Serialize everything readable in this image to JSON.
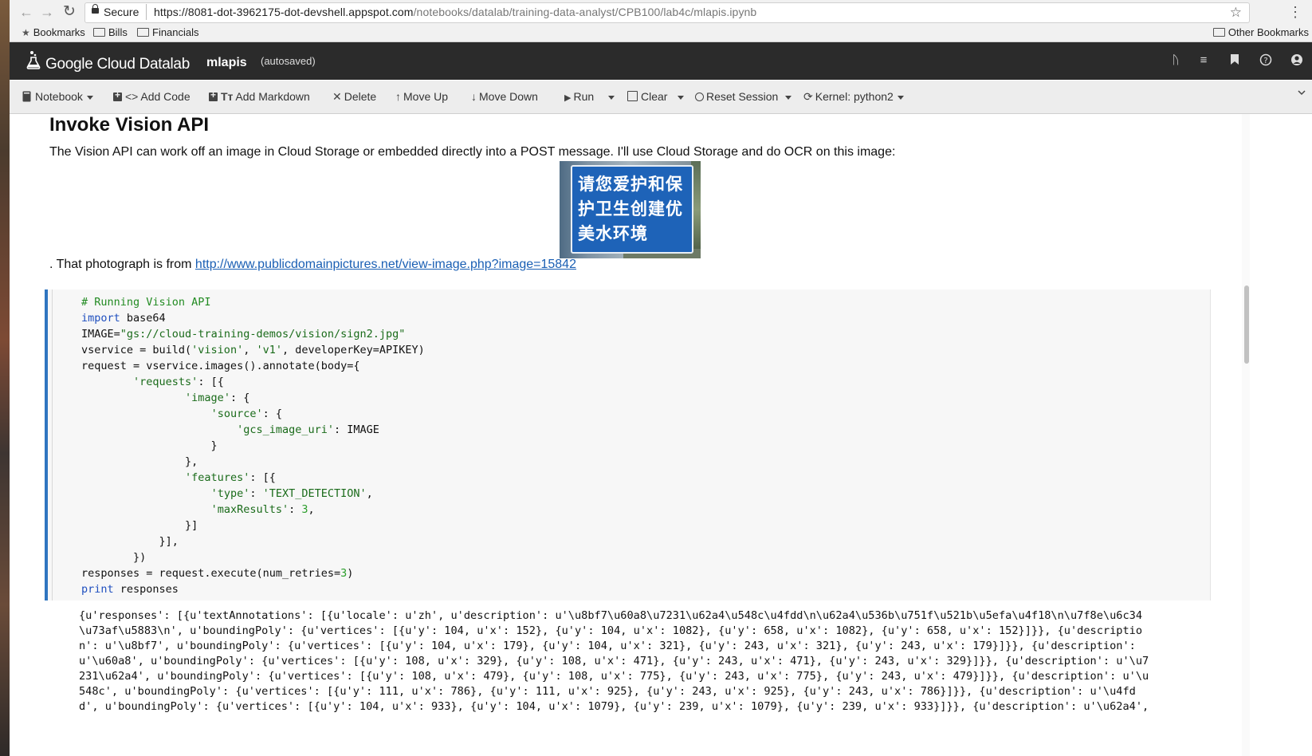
{
  "browser": {
    "secure_label": "Secure",
    "url_host": "https://8081-dot-3962175-dot-devshell.appspot.com",
    "url_path": "/notebooks/datalab/training-data-analyst/CPB100/lab4c/mlapis.ipynb",
    "bookmarks": [
      "Bookmarks",
      "Bills",
      "Financials"
    ],
    "other_bookmarks": "Other Bookmarks"
  },
  "header": {
    "logo": "Google Cloud Datalab",
    "notebook_name": "mlapis",
    "save_status": "(autosaved)",
    "icons": [
      "branch-icon",
      "list-icon",
      "bookmark-icon",
      "help-icon",
      "account-icon"
    ]
  },
  "toolbar": {
    "notebook": "Notebook",
    "add_code": "Add Code",
    "add_markdown": "Add Markdown",
    "delete": "Delete",
    "move_up": "Move Up",
    "move_down": "Move Down",
    "run": "Run",
    "clear": "Clear",
    "reset_session": "Reset Session",
    "kernel": "Kernel: python2"
  },
  "markdown": {
    "title": "Invoke Vision API",
    "para": "The Vision API can work off an image in Cloud Storage or embedded directly into a POST message. I'll use Cloud Storage and do OCR on this image:",
    "sign_lines": [
      "请您爱护和保",
      "护卫生创建优",
      "美水环境"
    ],
    "source_prefix": ". That photograph is from ",
    "source_link": "http://www.publicdomainpictures.net/view-image.php?image=15842"
  },
  "code_cell": {
    "lines": [
      "# Running Vision API",
      "import base64",
      "IMAGE=\"gs://cloud-training-demos/vision/sign2.jpg\"",
      "vservice = build('vision', 'v1', developerKey=APIKEY)",
      "request = vservice.images().annotate(body={",
      "        'requests': [{",
      "                'image': {",
      "                    'source': {",
      "                        'gcs_image_uri': IMAGE",
      "                    }",
      "                },",
      "                'features': [{",
      "                    'type': 'TEXT_DETECTION',",
      "                    'maxResults': 3,",
      "                }]",
      "            }],",
      "        })",
      "responses = request.execute(num_retries=3)",
      "print responses"
    ]
  },
  "output": {
    "lines": [
      "{u'responses': [{u'textAnnotations': [{u'locale': u'zh', u'description': u'\\u8bf7\\u60a8\\u7231\\u62a4\\u548c\\u4fdd\\n\\u62a4\\u536b\\u751f\\u521b\\u5efa\\u4f18\\n\\u7f8e\\u6c34",
      "\\u73af\\u5883\\n', u'boundingPoly': {u'vertices': [{u'y': 104, u'x': 152}, {u'y': 104, u'x': 1082}, {u'y': 658, u'x': 1082}, {u'y': 658, u'x': 152}]}}, {u'descriptio",
      "n': u'\\u8bf7', u'boundingPoly': {u'vertices': [{u'y': 104, u'x': 179}, {u'y': 104, u'x': 321}, {u'y': 243, u'x': 321}, {u'y': 243, u'x': 179}]}}, {u'description':",
      "u'\\u60a8', u'boundingPoly': {u'vertices': [{u'y': 108, u'x': 329}, {u'y': 108, u'x': 471}, {u'y': 243, u'x': 471}, {u'y': 243, u'x': 329}]}}, {u'description': u'\\u7",
      "231\\u62a4', u'boundingPoly': {u'vertices': [{u'y': 108, u'x': 479}, {u'y': 108, u'x': 775}, {u'y': 243, u'x': 775}, {u'y': 243, u'x': 479}]}}, {u'description': u'\\u",
      "548c', u'boundingPoly': {u'vertices': [{u'y': 111, u'x': 786}, {u'y': 111, u'x': 925}, {u'y': 243, u'x': 925}, {u'y': 243, u'x': 786}]}}, {u'description': u'\\u4fd",
      "d', u'boundingPoly': {u'vertices': [{u'y': 104, u'x': 933}, {u'y': 104, u'x': 1079}, {u'y': 239, u'x': 1079}, {u'y': 239, u'x': 933}]}}, {u'description': u'\\u62a4',"
    ]
  }
}
